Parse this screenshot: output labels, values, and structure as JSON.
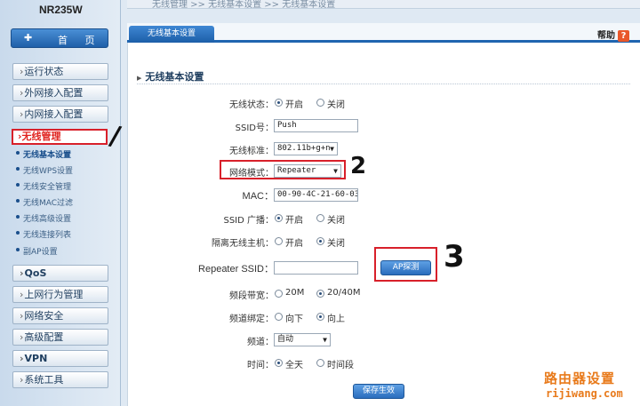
{
  "brand": "NR235W",
  "home_button": {
    "icon": "home-icon",
    "label": "首 页",
    "icon_glyph": "✚"
  },
  "sidebar": {
    "items": [
      {
        "label": "运行状态"
      },
      {
        "label": "外网接入配置"
      },
      {
        "label": "内网接入配置"
      },
      {
        "label": "无线管理"
      },
      {
        "label": "QoS"
      },
      {
        "label": "上网行为管理"
      },
      {
        "label": "网络安全"
      },
      {
        "label": "高级配置"
      },
      {
        "label": "VPN"
      },
      {
        "label": "系统工具"
      }
    ],
    "arrow": "›",
    "submenu": [
      {
        "label": "无线基本设置"
      },
      {
        "label": "无线WPS设置"
      },
      {
        "label": "无线安全管理"
      },
      {
        "label": "无线MAC过滤"
      },
      {
        "label": "无线高级设置"
      },
      {
        "label": "无线连接列表"
      },
      {
        "label": "副AP设置"
      }
    ]
  },
  "breadcrumb": "无线管理 >> 无线基本设置 >> 无线基本设置",
  "tab": {
    "label": "无线基本设置"
  },
  "help": {
    "label": "帮助",
    "icon_glyph": "?"
  },
  "section_title": "无线基本设置",
  "form": {
    "wireless_status": {
      "label": "无线状态：",
      "on": "开启",
      "off": "关闭"
    },
    "ssid": {
      "label": "SSID号：",
      "value": "Push"
    },
    "standard": {
      "label": "无线标准：",
      "value": "802.11b+g+n"
    },
    "network_mode": {
      "label": "网络模式：",
      "value": "Repeater"
    },
    "mac": {
      "label": "MAC：",
      "value": "00-90-4C-21-60-03"
    },
    "ssid_broadcast": {
      "label": "SSID 广播：",
      "on": "开启",
      "off": "关闭"
    },
    "isolation": {
      "label": "隔离无线主机：",
      "on": "开启",
      "off": "关闭"
    },
    "repeater_ssid": {
      "label": "Repeater SSID：",
      "value": "",
      "scan_button": "AP探测"
    },
    "bandwidth": {
      "label": "频段带宽：",
      "opt1": "20M",
      "opt2": "20/40M"
    },
    "channel_bind": {
      "label": "频道绑定：",
      "opt1": "向下",
      "opt2": "向上"
    },
    "channel": {
      "label": "频道：",
      "value": "自动"
    },
    "time": {
      "label": "时间：",
      "opt1": "全天",
      "opt2": "时间段"
    },
    "save_button": "保存生效"
  },
  "annotations": {
    "one": "/",
    "two": "2",
    "three": "3"
  },
  "watermark": {
    "line1": "路由器设置",
    "line2": "rijiwang.com"
  },
  "colors": {
    "accent": "#1f65b0",
    "highlight": "#d8202a",
    "watermark": "#e87a1b"
  }
}
